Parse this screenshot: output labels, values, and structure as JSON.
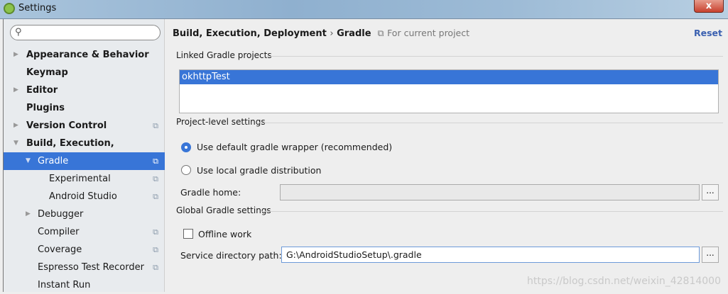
{
  "window": {
    "title": "Settings",
    "close_label": "x"
  },
  "sidebar": {
    "search_placeholder": "",
    "items": [
      {
        "label": "Appearance & Behavior"
      },
      {
        "label": "Keymap"
      },
      {
        "label": "Editor"
      },
      {
        "label": "Plugins"
      },
      {
        "label": "Version Control"
      },
      {
        "label": "Build, Execution, Deployment"
      },
      {
        "label": "Gradle"
      },
      {
        "label": "Experimental"
      },
      {
        "label": "Android Studio"
      },
      {
        "label": "Debugger"
      },
      {
        "label": "Compiler"
      },
      {
        "label": "Coverage"
      },
      {
        "label": "Espresso Test Recorder"
      },
      {
        "label": "Instant Run"
      }
    ]
  },
  "header": {
    "crumb_parent": "Build, Execution, Deployment",
    "sep": "›",
    "crumb_current": "Gradle",
    "scope": "For current project",
    "reset": "Reset"
  },
  "linked": {
    "title": "Linked Gradle projects",
    "projects": [
      "okhttpTest"
    ]
  },
  "project_level": {
    "title": "Project-level settings",
    "radio_wrapper": "Use default gradle wrapper (recommended)",
    "radio_local": "Use local gradle distribution",
    "selected": "wrapper",
    "gradle_home_label": "Gradle home:",
    "gradle_home_value": "",
    "browse": "..."
  },
  "global": {
    "title": "Global Gradle settings",
    "offline_label": "Offline work",
    "offline_checked": false,
    "service_dir_label": "Service directory path:",
    "service_dir_value": "G:\\AndroidStudioSetup\\.gradle",
    "browse": "..."
  },
  "watermark": "https://blog.csdn.net/weixin_42814000"
}
